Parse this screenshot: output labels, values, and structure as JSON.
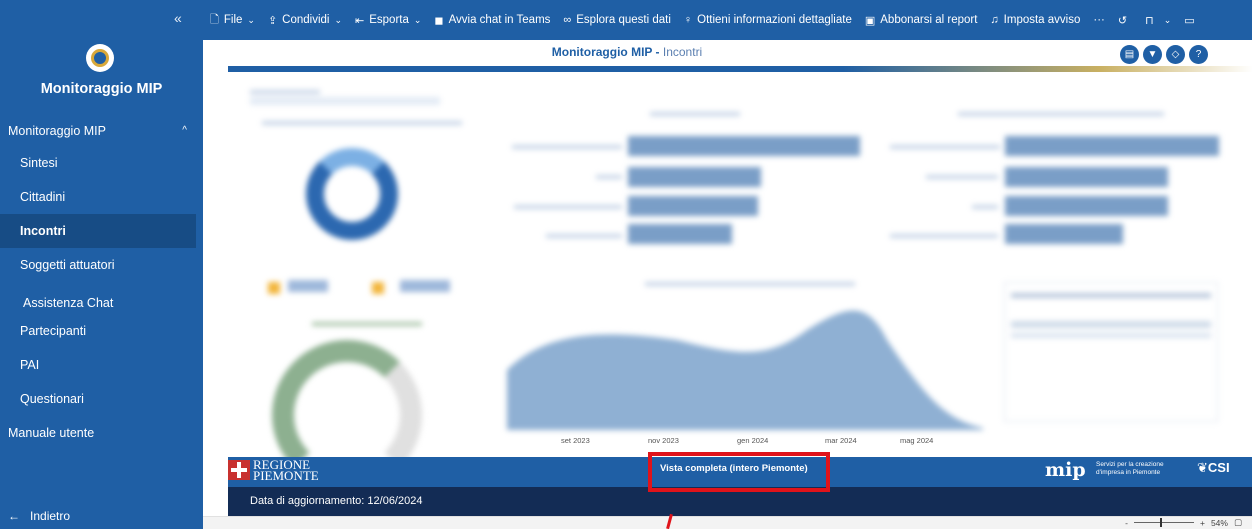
{
  "sidebar": {
    "collapse_glyph": "«",
    "app_name": "Monitoraggio MIP",
    "group_label": "Monitoraggio MIP",
    "items": [
      {
        "label": "Sintesi"
      },
      {
        "label": "Cittadini"
      },
      {
        "label": "Incontri",
        "active": true
      },
      {
        "label": "Soggetti attuatori"
      },
      {
        "label": "Assistenza Chat"
      },
      {
        "label": "Partecipanti"
      },
      {
        "label": "PAI"
      },
      {
        "label": "Questionari"
      }
    ],
    "manual_label": "Manuale utente",
    "back_label": "Indietro"
  },
  "toolbar": {
    "file": "File",
    "share": "Condividi",
    "export": "Esporta",
    "teams": "Avvia chat in Teams",
    "explore": "Esplora questi dati",
    "insights": "Ottieni informazioni dettagliate",
    "subscribe": "Abbonarsi al report",
    "alert": "Imposta avviso",
    "more": "···"
  },
  "report": {
    "title": "Monitoraggio MIP - ",
    "subtitle": "Incontri",
    "x_ticks": [
      "set 2023",
      "nov 2023",
      "gen 2024",
      "mar 2024",
      "mag 2024"
    ]
  },
  "footer": {
    "regione_line1": "REGIONE",
    "regione_line2": "PIEMONTE",
    "scope": "Vista completa (intero Piemonte)",
    "mip": "mip",
    "mip_tagline_1": "Servizi per la creazione",
    "mip_tagline_2": "d'impresa in Piemonte",
    "csi": "CSI",
    "update": "Data di aggiornamento: 12/06/2024"
  },
  "status": {
    "zoom": "54%",
    "minus": "-",
    "plus": "+"
  },
  "colors": {
    "brand_blue": "#1f5fa5",
    "highlight_red": "#e0131a",
    "dark_band": "#132c55"
  }
}
